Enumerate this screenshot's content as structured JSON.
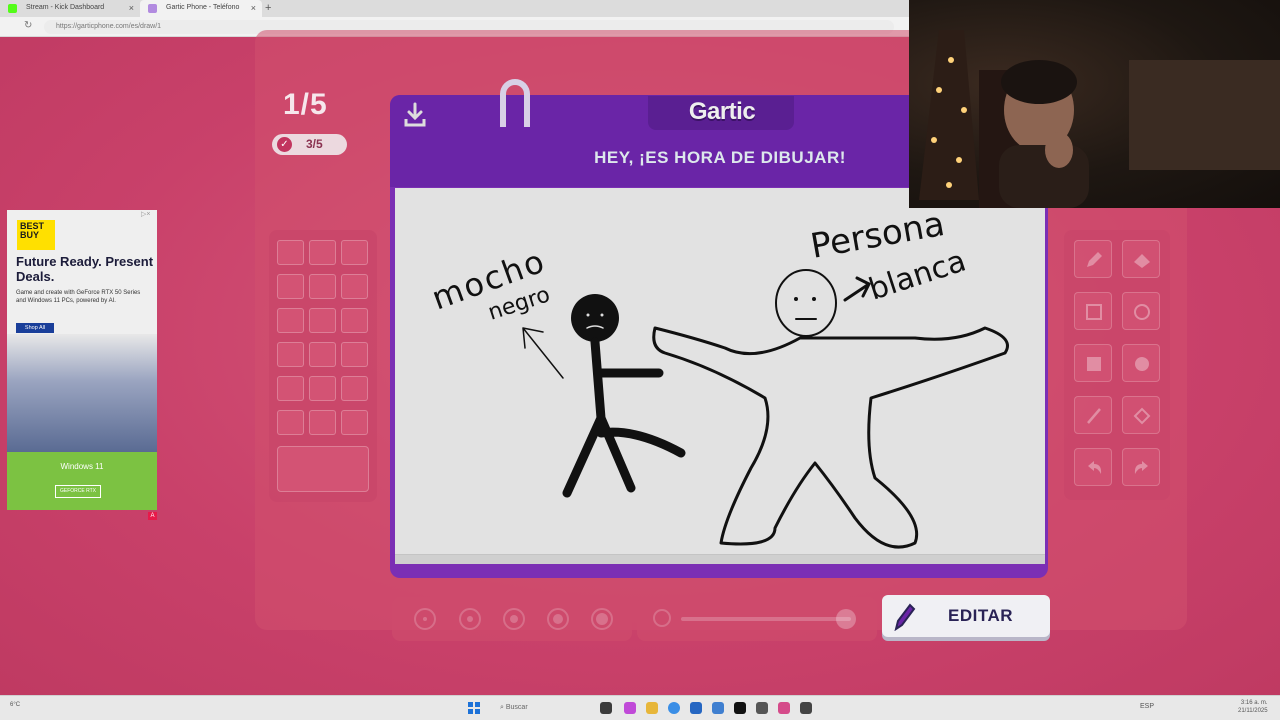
{
  "browser": {
    "tabs": [
      {
        "label": "Stream - Kick Dashboard",
        "icon": "kick-icon",
        "color": "#53fc18"
      },
      {
        "label": "Gartic Phone - Teléfono Descompuesto",
        "icon": "gartic-icon",
        "color": "#7b2fb4"
      }
    ],
    "new_tab": "+",
    "url": "https://garticphone.com/es/draw/1"
  },
  "game": {
    "round": "1/5",
    "players_done": "3/5",
    "logo": "Gartic",
    "prompt": "HEY, ¡ES HORA DE DIBUJAR!",
    "edit_button": "EDITAR",
    "colors": {
      "board": "#7b2fb4",
      "page_bg": "#c9416a",
      "canvas": "#e2e2e2"
    },
    "drawing_text": [
      "mocho",
      "negro",
      "Persona",
      "blanca"
    ]
  },
  "ad": {
    "brand": "BEST BUY",
    "headline": "Future Ready. Present Deals.",
    "body": "Game and create with GeForce RTX 50 Series and Windows 11 PCs, powered by AI.",
    "cta": "Shop All",
    "windows": "Windows 11",
    "geforce": "GEFORCE RTX"
  },
  "taskbar": {
    "weather": "6°C",
    "search": "Buscar",
    "tray_lang": "ESP",
    "clock_time": "3:16 a. m.",
    "clock_date": "21/11/2025"
  }
}
